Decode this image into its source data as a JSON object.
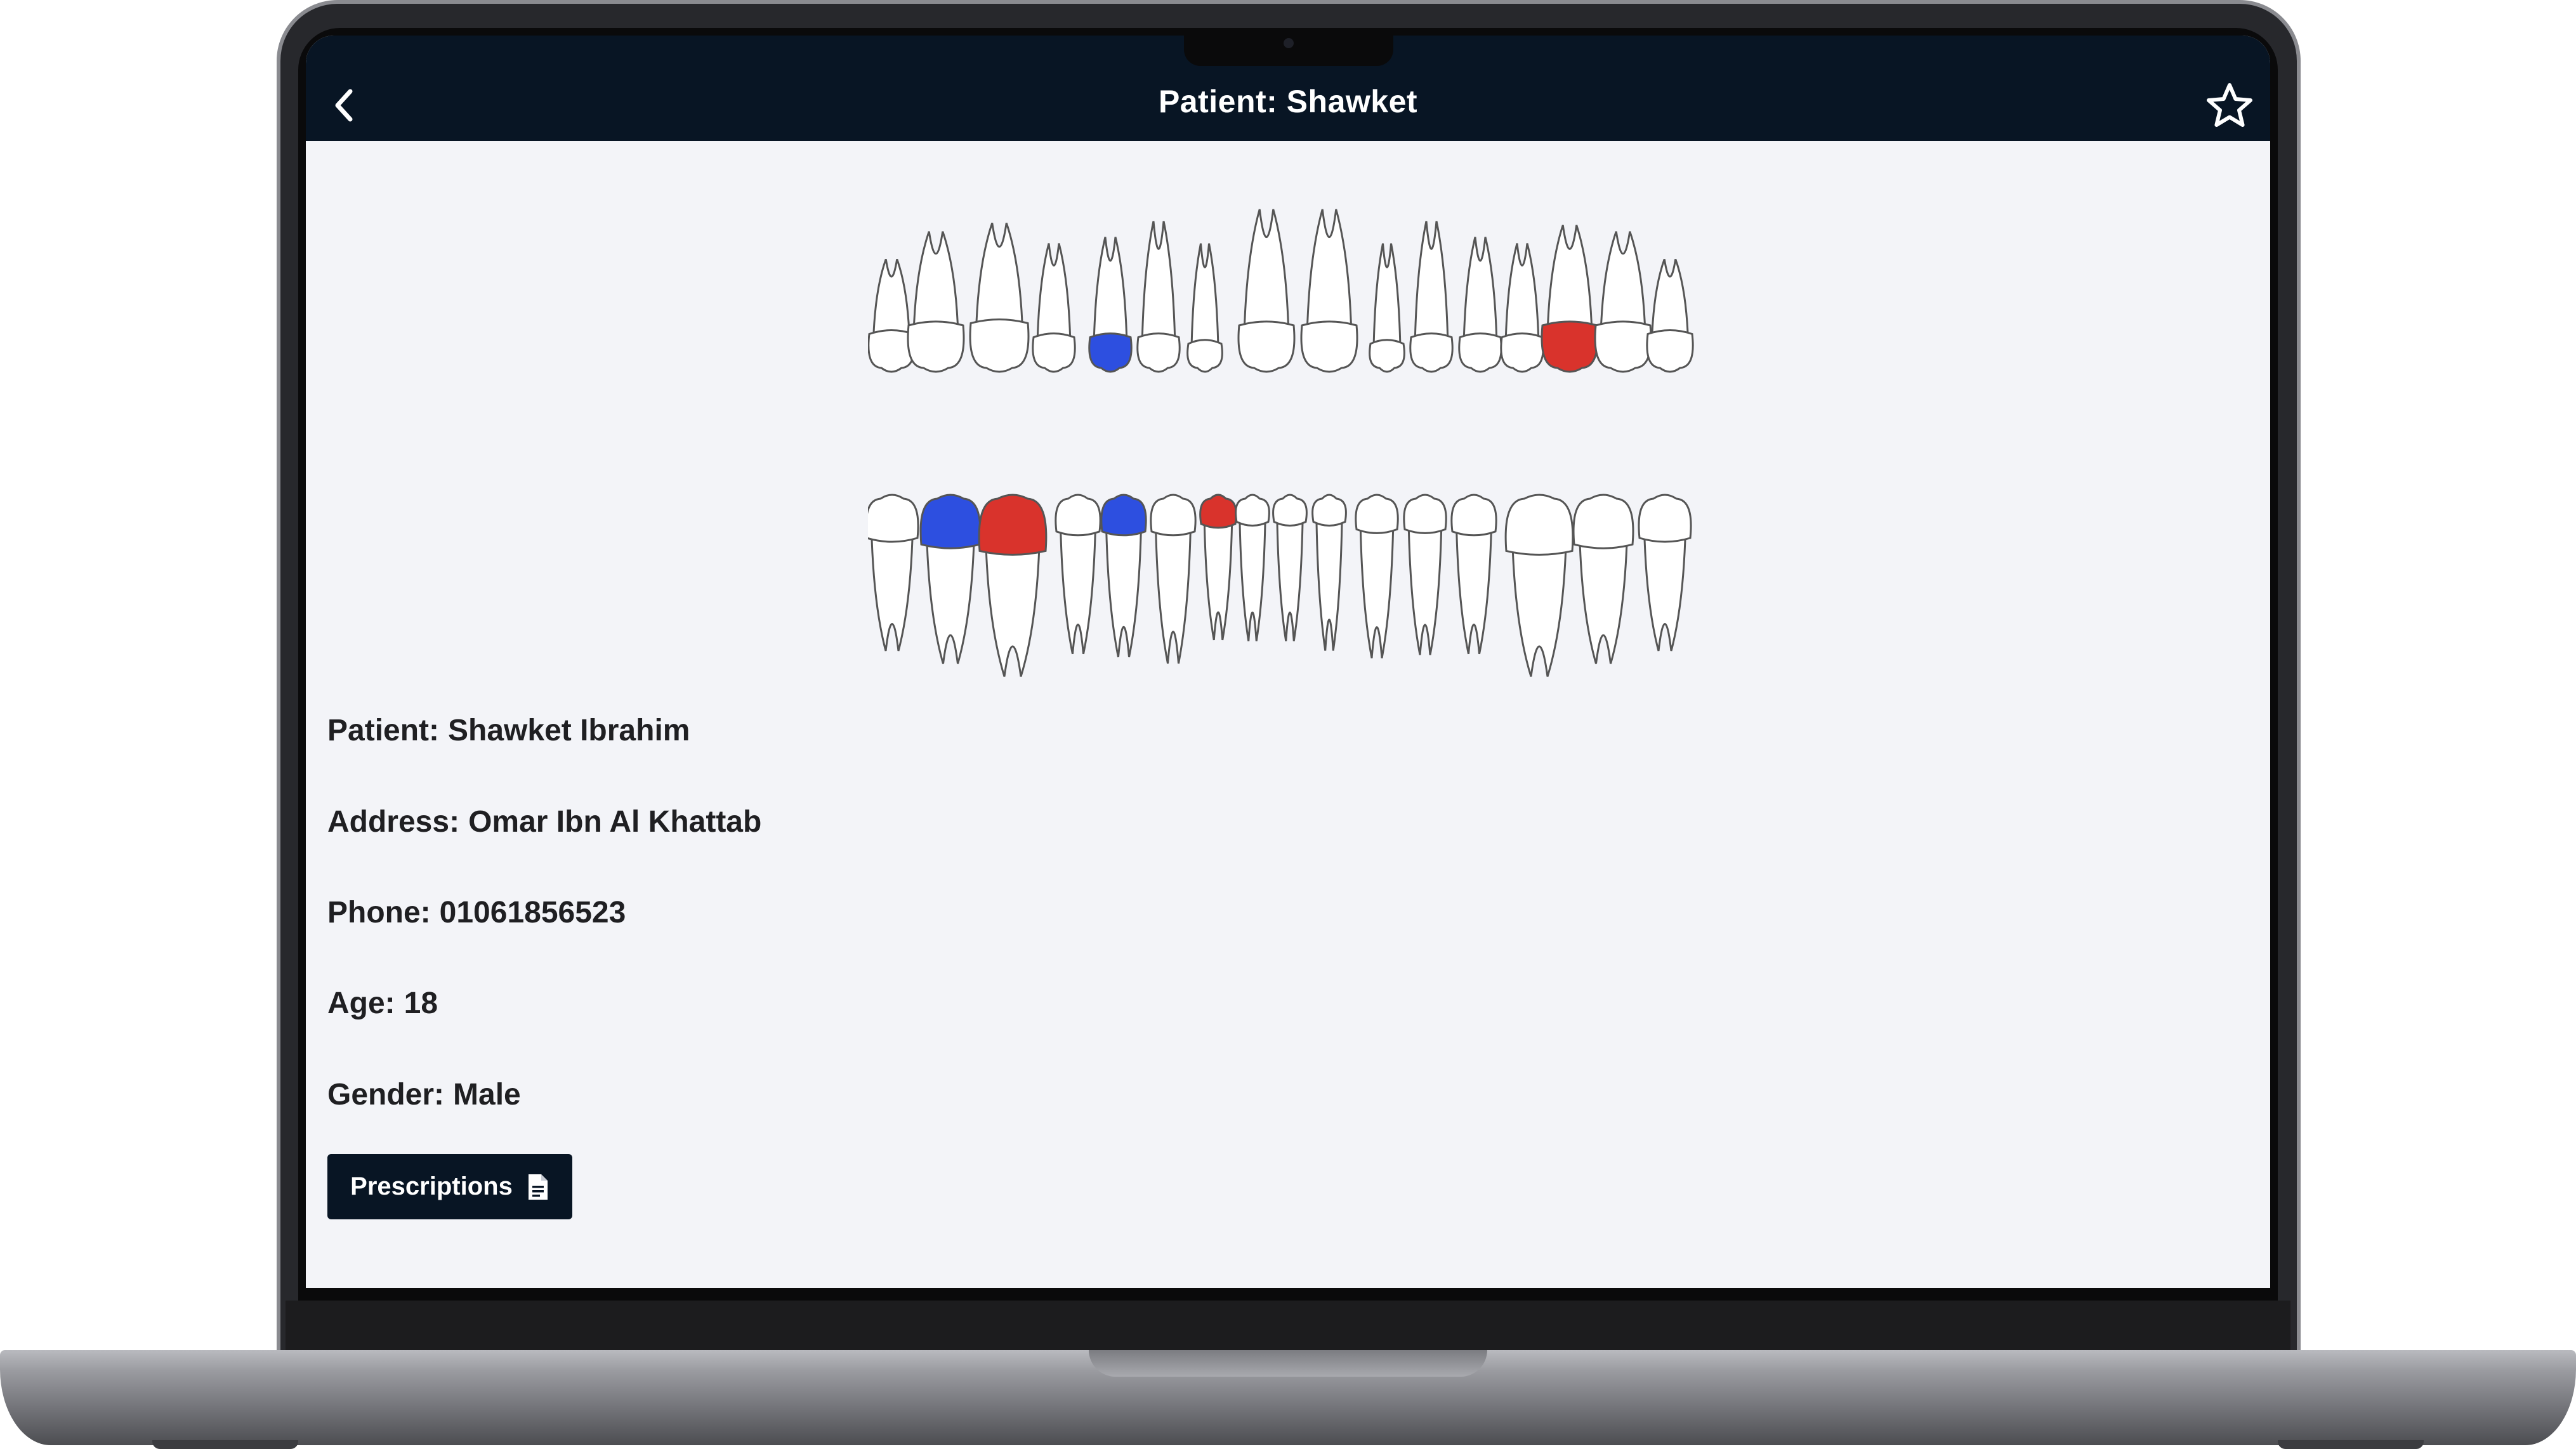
{
  "appbar": {
    "title": "Patient: Shawket",
    "back_icon": "chevron-left-icon",
    "favorite_icon": "star-outline-icon"
  },
  "patient": {
    "name_label": "Patient:",
    "name": "Shawket Ibrahim",
    "address_label": "Address:",
    "address": "Omar Ibn Al Khattab",
    "phone_label": "Phone:",
    "phone": "01061856523",
    "age_label": "Age:",
    "age": "18",
    "gender_label": "Gender:",
    "gender": "Male"
  },
  "actions": {
    "prescriptions_label": "Prescriptions",
    "prescriptions_icon": "document-icon"
  },
  "teeth_chart": {
    "colors": {
      "blue": "#2d4fe0",
      "red": "#d9332c",
      "healthy": "#ffffff",
      "outline": "#555555"
    },
    "upper": [
      "healthy",
      "healthy",
      "healthy",
      "healthy",
      "blue",
      "healthy",
      "healthy",
      "healthy",
      "healthy",
      "healthy",
      "healthy",
      "healthy",
      "healthy",
      "red",
      "healthy",
      "healthy"
    ],
    "lower": [
      "healthy",
      "blue",
      "red",
      "healthy",
      "blue",
      "healthy",
      "red",
      "healthy",
      "healthy",
      "healthy",
      "healthy",
      "healthy",
      "healthy",
      "healthy",
      "healthy",
      "healthy"
    ]
  },
  "theme": {
    "appbar_bg": "#081524",
    "screen_bg": "#f3f4f8"
  }
}
